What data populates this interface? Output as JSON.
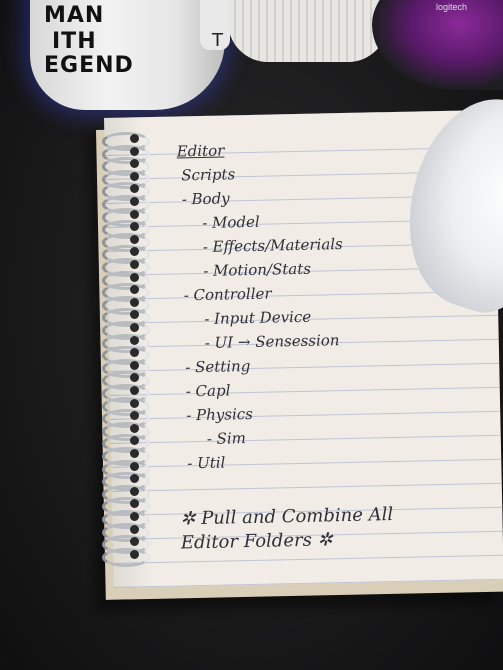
{
  "mug": {
    "lines": [
      "MAN",
      "ITH",
      "EGEND"
    ]
  },
  "ramekin": {
    "letter": "T"
  },
  "mouse": {
    "logo": "logitech"
  },
  "notebook": {
    "lines": [
      {
        "text": "Editor",
        "indent": 0,
        "title": true
      },
      {
        "text": "Scripts",
        "indent": 0
      },
      {
        "text": "- Body",
        "indent": 1
      },
      {
        "text": "- Model",
        "indent": 2
      },
      {
        "text": "- Effects/Materials",
        "indent": 2
      },
      {
        "text": "- Motion/Stats",
        "indent": 2
      },
      {
        "text": "- Controller",
        "indent": 1
      },
      {
        "text": "- Input Device",
        "indent": 2
      },
      {
        "text": "- UI → Sensession",
        "indent": 2
      },
      {
        "text": "- Setting",
        "indent": 1
      },
      {
        "text": "- Capl",
        "indent": 1
      },
      {
        "text": "- Physics",
        "indent": 1
      },
      {
        "text": "- Sim",
        "indent": 2
      },
      {
        "text": "- Util",
        "indent": 1
      },
      {
        "text": "",
        "indent": 0
      },
      {
        "text": "✲ Pull and Combine All",
        "indent": 1
      },
      {
        "text": "Editor Folders ✲",
        "indent": 1
      }
    ]
  }
}
